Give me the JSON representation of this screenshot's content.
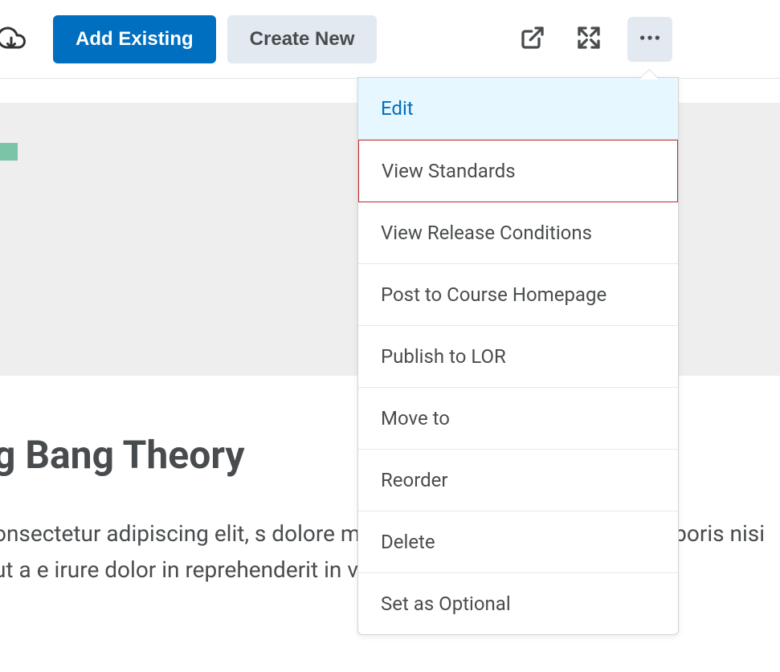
{
  "toolbar": {
    "add_existing_label": "Add Existing",
    "create_new_label": "Create New"
  },
  "menu": {
    "items": [
      {
        "label": "Edit",
        "highlighted": true
      },
      {
        "label": "View Standards",
        "boxed": true
      },
      {
        "label": "View Release Conditions"
      },
      {
        "label": "Post to Course Homepage"
      },
      {
        "label": "Publish to LOR"
      },
      {
        "label": "Move to"
      },
      {
        "label": "Reorder"
      },
      {
        "label": "Delete"
      },
      {
        "label": "Set as Optional"
      }
    ]
  },
  "content": {
    "title": "g Bang Theory",
    "body": "onsectetur adipiscing elit, s dolore magna aliqua. Ut er on ullamco laboris nisi ut a e irure dolor in reprehenderit in voluptate"
  }
}
